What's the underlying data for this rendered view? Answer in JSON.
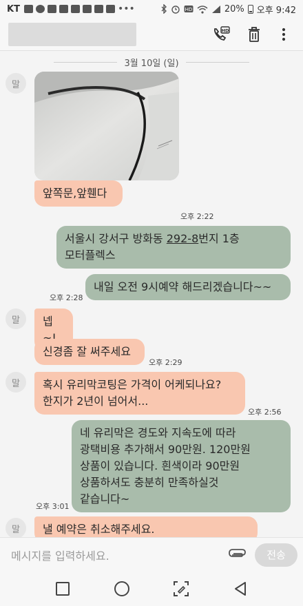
{
  "status_bar": {
    "carrier": "KT",
    "battery": "20%",
    "time": "오후 9:42"
  },
  "header": {
    "icons": [
      "hd-call-icon",
      "trash-icon",
      "more-vert-icon"
    ]
  },
  "chat": {
    "date": "3월 10일 (일)",
    "avatar_label": "말",
    "messages": [
      {
        "dir": "in",
        "type": "image",
        "alt": "car door photo"
      },
      {
        "dir": "in",
        "text": "앞쪽문,앞휀다",
        "time": "오후 2:22"
      },
      {
        "dir": "out",
        "line1_pre": "서울시 강서구 방화동 ",
        "line1_link": "292-8",
        "line1_post": "번지 1층",
        "line2": "모터플렉스"
      },
      {
        "dir": "out",
        "text": "내일 오전 9시예약 해드리겠습니다~~",
        "time": "오후 2:28"
      },
      {
        "dir": "in",
        "text": "넵~!"
      },
      {
        "dir": "in",
        "text": "신경좀 잘 써주세요",
        "time": "오후 2:29"
      },
      {
        "dir": "in",
        "line1": "혹시 유리막코팅은 가격이 어케되나요?",
        "line2": "한지가 2년이 넘어서...",
        "time": "오후 2:56"
      },
      {
        "dir": "out",
        "line1": "네 유리막은 경도와 지속도에 따라",
        "line2": "광택비용 추가해서 90만원. 120만원",
        "line3": "상품이 있습니다. 흰색이라 90만원",
        "line4": "상품하셔도 충분히 만족하실것",
        "line5": "같습니다~",
        "time": "오후 3:01"
      },
      {
        "dir": "in",
        "text": "낼 예약은 취소해주세요."
      }
    ]
  },
  "input": {
    "placeholder": "메시지를 입력하세요.",
    "send_label": "전송"
  },
  "navbar": {
    "icons": [
      "recent-apps-icon",
      "home-icon",
      "screenshot-icon",
      "back-icon"
    ]
  }
}
